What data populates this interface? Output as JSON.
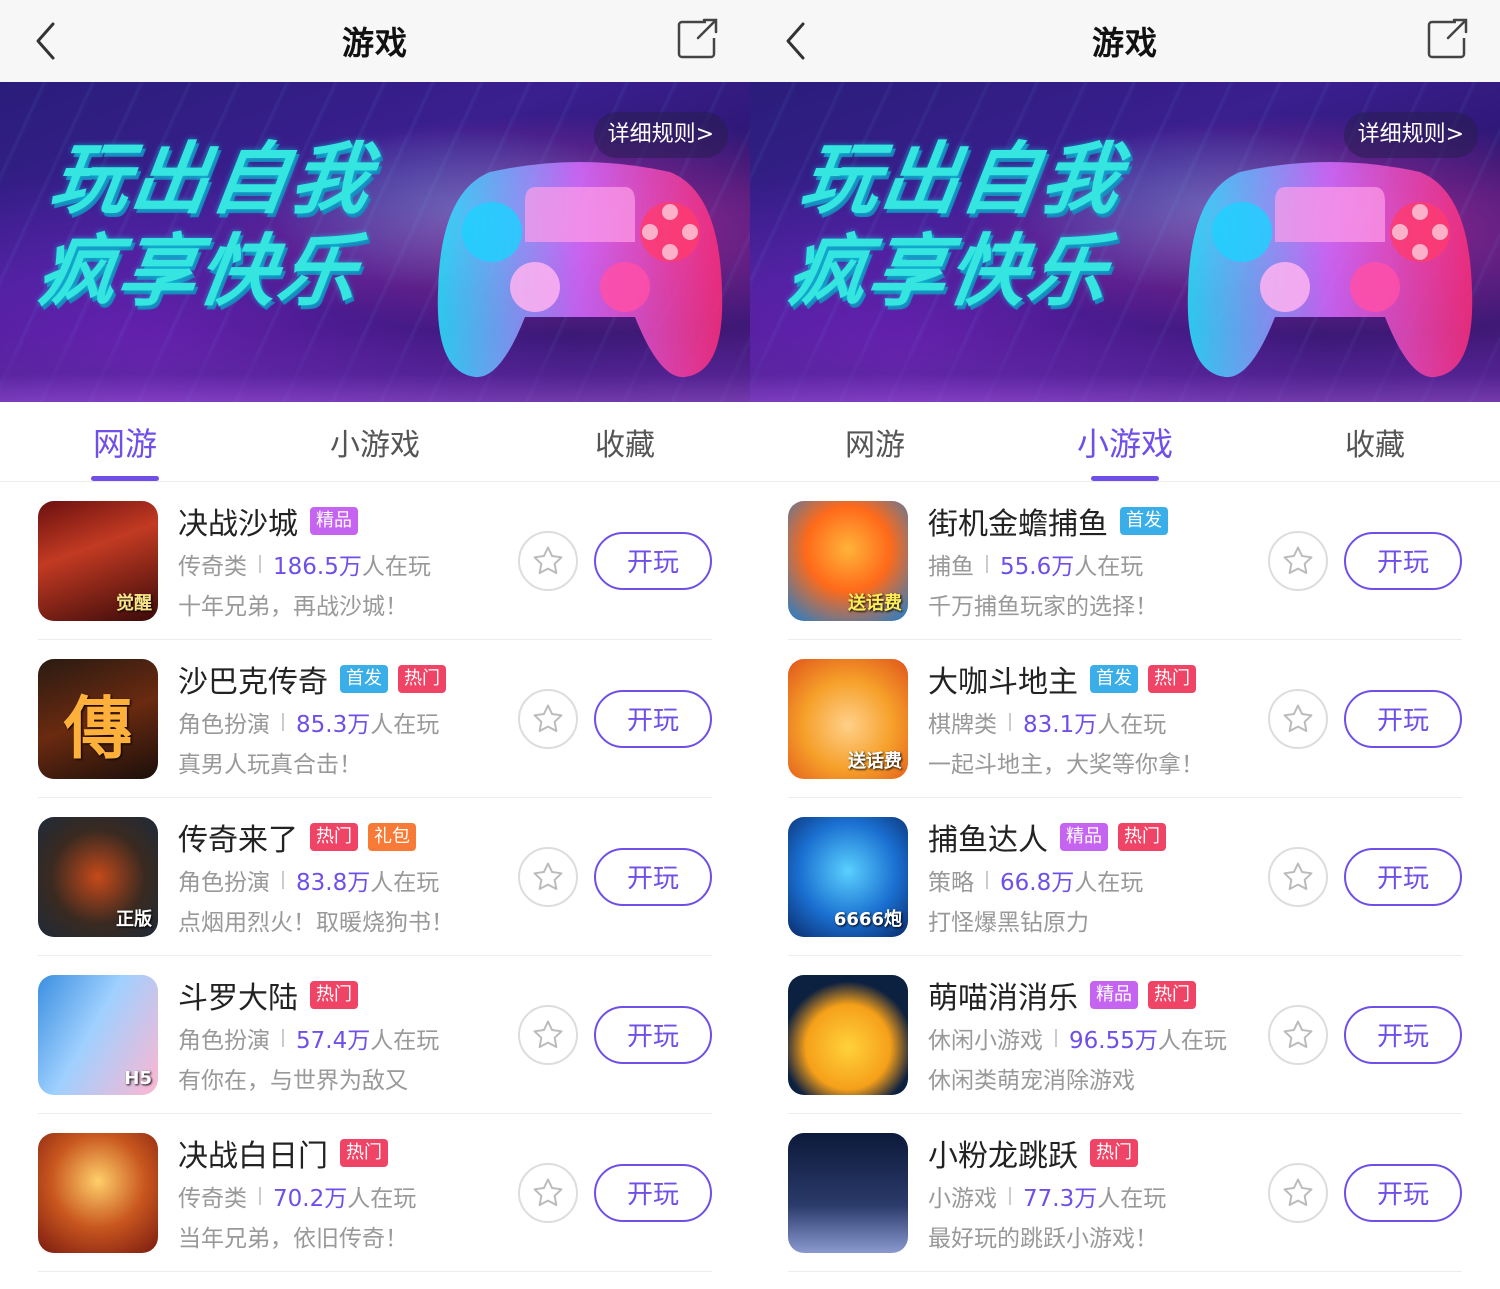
{
  "colors": {
    "accent": "#6f4fe8",
    "badge_精品": "#c464f0",
    "badge_首发": "#3aaee8",
    "badge_热门": "#f04466",
    "badge_礼包": "#f77a36"
  },
  "screens": [
    {
      "header": {
        "title": "游戏"
      },
      "banner": {
        "slogan_line1": "玩出自我",
        "slogan_line2": "疯享快乐",
        "rules_link": "详细规则>"
      },
      "tabs": [
        {
          "label": "网游",
          "active": true
        },
        {
          "label": "小游戏",
          "active": false
        },
        {
          "label": "收藏",
          "active": false
        }
      ],
      "items": [
        {
          "name": "决战沙城",
          "badges": [
            "精品"
          ],
          "category": "传奇类",
          "count": "186.5万",
          "suffix": "人在玩",
          "desc": "十年兄弟，再战沙城！",
          "play": "开玩",
          "icon": "game-icon-juezhan-shacheng",
          "icon_text": "觉醒"
        },
        {
          "name": "沙巴克传奇",
          "badges": [
            "首发",
            "热门"
          ],
          "category": "角色扮演",
          "count": "85.3万",
          "suffix": "人在玩",
          "desc": "真男人玩真合击！",
          "play": "开玩",
          "icon": "game-icon-shabake",
          "icon_text": "傳"
        },
        {
          "name": "传奇来了",
          "badges": [
            "热门",
            "礼包"
          ],
          "category": "角色扮演",
          "count": "83.8万",
          "suffix": "人在玩",
          "desc": "点烟用烈火！取暖烧狗书！",
          "play": "开玩",
          "icon": "game-icon-chuanqi-laile",
          "icon_text": "正版"
        },
        {
          "name": "斗罗大陆",
          "badges": [
            "热门"
          ],
          "category": "角色扮演",
          "count": "57.4万",
          "suffix": "人在玩",
          "desc": "有你在，与世界为敌又",
          "play": "开玩",
          "icon": "game-icon-douluo",
          "icon_text": "H5"
        },
        {
          "name": "决战白日门",
          "badges": [
            "热门"
          ],
          "category": "传奇类",
          "count": "70.2万",
          "suffix": "人在玩",
          "desc": "当年兄弟，依旧传奇！",
          "play": "开玩",
          "icon": "game-icon-bairimen",
          "icon_text": ""
        }
      ]
    },
    {
      "header": {
        "title": "游戏"
      },
      "banner": {
        "slogan_line1": "玩出自我",
        "slogan_line2": "疯享快乐",
        "rules_link": "详细规则>"
      },
      "tabs": [
        {
          "label": "网游",
          "active": false
        },
        {
          "label": "小游戏",
          "active": true
        },
        {
          "label": "收藏",
          "active": false
        }
      ],
      "items": [
        {
          "name": "街机金蟾捕鱼",
          "badges": [
            "首发"
          ],
          "category": "捕鱼",
          "count": "55.6万",
          "suffix": "人在玩",
          "desc": "千万捕鱼玩家的选择！",
          "play": "开玩",
          "icon": "game-icon-jinchan-buyu",
          "icon_text": "送话费"
        },
        {
          "name": "大咖斗地主",
          "badges": [
            "首发",
            "热门"
          ],
          "category": "棋牌类",
          "count": "83.1万",
          "suffix": "人在玩",
          "desc": "一起斗地主，大奖等你拿！",
          "play": "开玩",
          "icon": "game-icon-daka-doudizhu",
          "icon_text": "送话费"
        },
        {
          "name": "捕鱼达人",
          "badges": [
            "精品",
            "热门"
          ],
          "category": "策略",
          "count": "66.8万",
          "suffix": "人在玩",
          "desc": "打怪爆黑钻原力",
          "play": "开玩",
          "icon": "game-icon-buyu-daren",
          "icon_text": "6666炮"
        },
        {
          "name": "萌喵消消乐",
          "badges": [
            "精品",
            "热门"
          ],
          "category": "休闲小游戏",
          "count": "96.55万",
          "suffix": "人在玩",
          "desc": "休闲类萌宠消除游戏",
          "play": "开玩",
          "icon": "game-icon-mengmiao",
          "icon_text": ""
        },
        {
          "name": "小粉龙跳跃",
          "badges": [
            "热门"
          ],
          "category": "小游戏",
          "count": "77.3万",
          "suffix": "人在玩",
          "desc": "最好玩的跳跃小游戏！",
          "play": "开玩",
          "icon": "game-icon-xiaofenlong",
          "icon_text": ""
        }
      ]
    }
  ]
}
